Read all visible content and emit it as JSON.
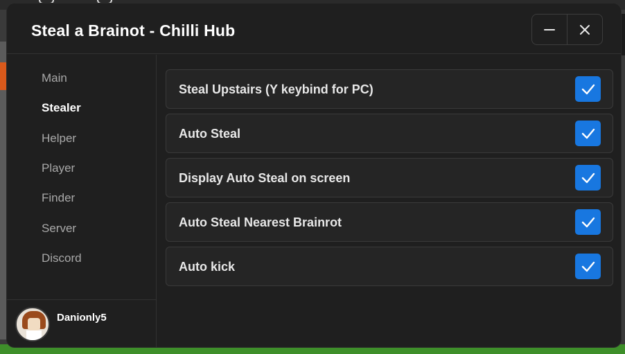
{
  "window": {
    "title": "Steal a Brainot - Chilli Hub",
    "minimize_icon": "minus-icon",
    "close_icon": "close-icon"
  },
  "sidebar": {
    "items": [
      {
        "label": "Main",
        "active": false
      },
      {
        "label": "Stealer",
        "active": true
      },
      {
        "label": "Helper",
        "active": false
      },
      {
        "label": "Player",
        "active": false
      },
      {
        "label": "Finder",
        "active": false
      },
      {
        "label": "Server",
        "active": false
      },
      {
        "label": "Discord",
        "active": false
      }
    ],
    "user": {
      "name": "Danionly5"
    }
  },
  "toggles": [
    {
      "label": "Steal Upstairs (Y keybind for PC)",
      "checked": true
    },
    {
      "label": "Auto Steal",
      "checked": true
    },
    {
      "label": "Display Auto Steal on screen",
      "checked": true
    },
    {
      "label": "Auto Steal Nearest Brainrot",
      "checked": true
    },
    {
      "label": "Auto kick",
      "checked": true
    }
  ],
  "colors": {
    "window_bg": "#1f1f1f",
    "row_bg": "#252525",
    "accent": "#1877e0",
    "text_primary": "#ffffff",
    "text_muted": "#a9a9a9"
  }
}
